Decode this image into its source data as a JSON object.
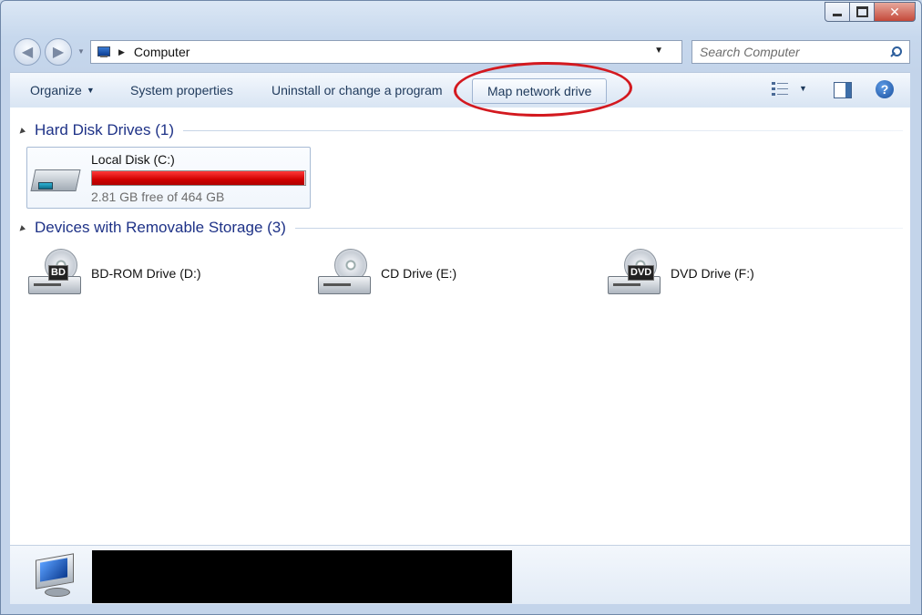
{
  "window": {
    "caption_buttons": {
      "minimize": "minimize",
      "maximize": "maximize",
      "close": "✕"
    }
  },
  "nav": {
    "back_glyph": "◀",
    "forward_glyph": "▶",
    "address_path": "Computer",
    "address_sep": "▶",
    "search_placeholder": "Search Computer",
    "refresh_glyph": "⇆"
  },
  "toolbar": {
    "organize": "Organize",
    "organize_arrow": "▼",
    "system_properties": "System properties",
    "uninstall": "Uninstall or change a program",
    "map_network_drive": "Map network drive",
    "view_arrow": "▼",
    "help": "?"
  },
  "groups": {
    "hard_disk": {
      "title": "Hard Disk Drives (1)"
    },
    "removable": {
      "title": "Devices with Removable Storage (3)"
    }
  },
  "drives": {
    "local": {
      "name": "Local Disk (C:)",
      "free_text": "2.81 GB free of 464 GB",
      "used_fraction": 0.994,
      "bar_color": "#d00000"
    },
    "bd": {
      "name": "BD-ROM Drive (D:)",
      "badge": "BD"
    },
    "cd": {
      "name": "CD Drive (E:)"
    },
    "dvd": {
      "name": "DVD Drive (F:)",
      "badge": "DVD"
    }
  },
  "annotation": {
    "color": "#d3191f",
    "highlights": "map_network_drive"
  },
  "icons": {
    "address": "computer-icon",
    "search": "search-icon",
    "view": "view-options-icon",
    "pane": "preview-pane-icon",
    "help": "help-icon"
  }
}
